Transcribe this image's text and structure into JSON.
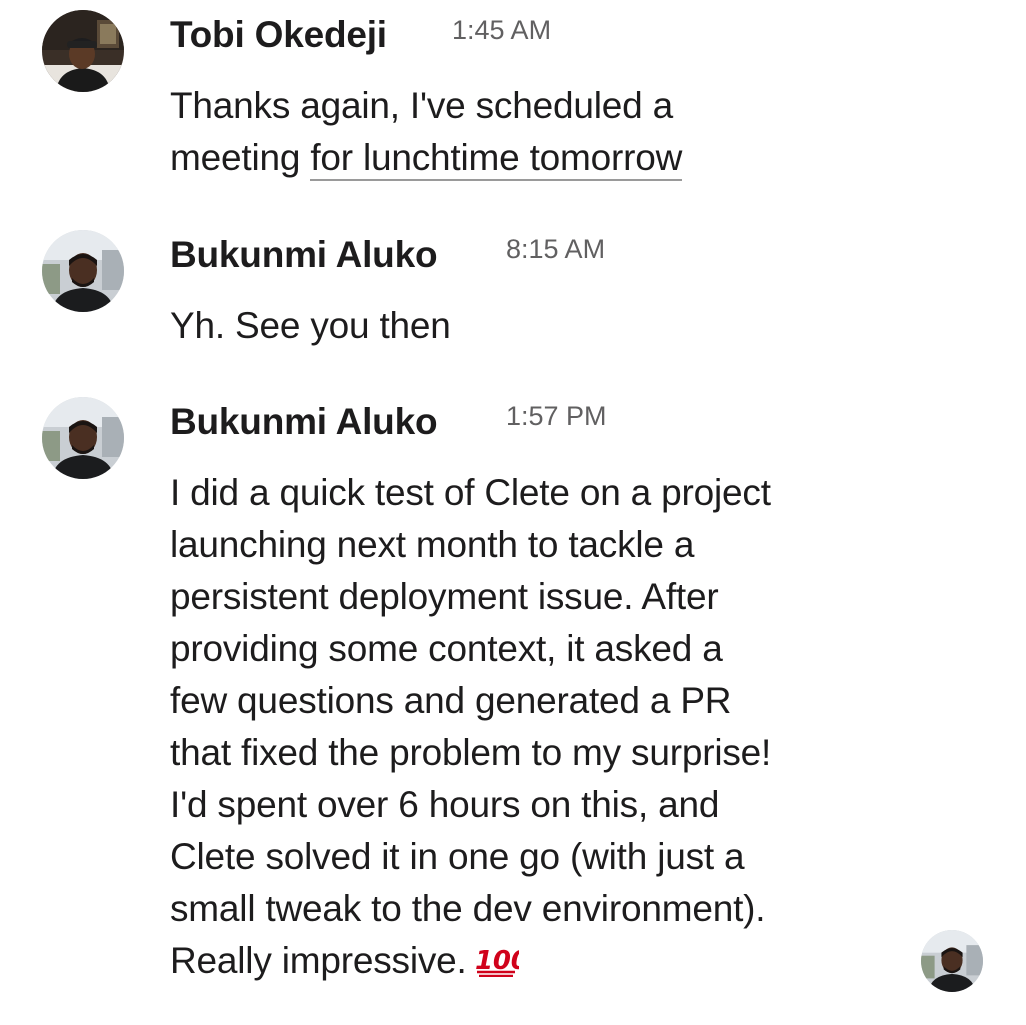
{
  "messages": [
    {
      "sender": "Tobi Okedeji",
      "time": "1:45 AM",
      "text_before": "Thanks again, I've scheduled a\nmeeting ",
      "text_link": "for lunchtime tomorrow",
      "avatar": "tobi-avatar"
    },
    {
      "sender": "Bukunmi Aluko",
      "time": "8:15 AM",
      "text": "Yh. See you then",
      "avatar": "bukunmi-avatar"
    },
    {
      "sender": "Bukunmi Aluko",
      "time": "1:57 PM",
      "text": "I did a quick test of Clete on a project\nlaunching next month to tackle a\npersistent deployment issue. After\nproviding some context, it asked a\nfew questions and generated a PR\nthat fixed the problem to my surprise!\nI'd spent over 6 hours on this, and\nClete solved it in one go (with just a\nsmall tweak to the dev environment).\nReally impressive.",
      "emoji": "hundred-points-icon",
      "avatar": "bukunmi-avatar"
    }
  ],
  "colors": {
    "text": "#1d1c1d",
    "timestamp": "#616061",
    "emoji": "#d0021b"
  }
}
